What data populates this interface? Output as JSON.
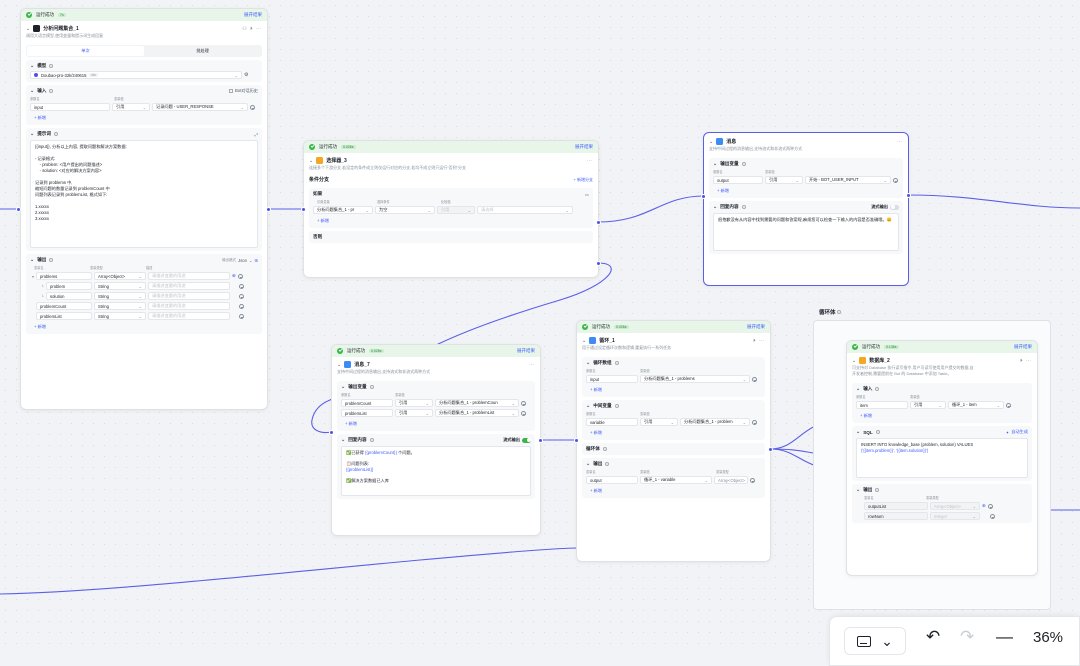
{
  "run_status": "运行成功",
  "expand_label": "展开结果",
  "add_label": "+ 新增",
  "node_llm": {
    "duration": "7s",
    "title": "分析问题集合_1",
    "desc": "调用大语言模型,使用变量和提示词生成回复",
    "tabs": [
      "单次",
      "批处理"
    ],
    "model_label": "模型",
    "model_value": "Doubao-pro-32k/240615",
    "model_tag": "ctx",
    "input_label": "输入",
    "history_label": "Bot对话历史",
    "col_name": "参数名",
    "col_value": "变量值",
    "input_rows": [
      {
        "name": "input",
        "ref": "引用",
        "value": "记录问题 - USER_RESPONSE"
      }
    ],
    "prompt_label": "提示词",
    "prompt_lines": [
      "{{input}}, 分析以上内容, 提取问题和解决方案数据:",
      "",
      "- 记录格式:",
      "    - problem: <用户提出的问题描述>",
      "    - solution: <对应的解决方案内容>",
      "",
      "记录到 problems 中,",
      "缩短问题的数量记录到 problemCount 中",
      "问题列表记录到 problemList, 格式如下:",
      "",
      "1.xxxxx",
      "2.xxxxx",
      "3.xxxxx"
    ],
    "output_label": "输出",
    "output_format_label": "输出格式",
    "output_format": "Json",
    "col_varname": "变量名",
    "col_vartype": "变量类型",
    "col_desc": "描述",
    "desc_placeholder": "请描述变量的用途",
    "output_rows": [
      {
        "name": "problems",
        "type": "Array<Object>",
        "indent": 0
      },
      {
        "name": "problem",
        "type": "String",
        "indent": 1
      },
      {
        "name": "solution",
        "type": "String",
        "indent": 1
      },
      {
        "name": "problemCount",
        "type": "String",
        "indent": 0
      },
      {
        "name": "problemList",
        "type": "String",
        "indent": 0
      }
    ]
  },
  "node_selector": {
    "duration": "0.026s",
    "title": "选择器_3",
    "desc": "连接多个下游分支,若设定的条件成立则仅运行对应的分支,若均不成立则只运行\"否则\"分支",
    "branch_label": "条件分支",
    "add_branch": "新增分支",
    "if_label": "如果",
    "col_ref": "引用变量",
    "col_op": "选择条件",
    "col_cmp": "比较值",
    "cond_ref": "分析问题集合_1 - pr",
    "cond_op": "为空",
    "cond_cmp_ref": "引用",
    "cond_cmp_ph": "请选择",
    "else_label": "否则"
  },
  "node_msg1": {
    "title": "消息",
    "desc": "支持中间过程的消息输出,支持流式和非流式两种方式",
    "output_var_label": "输出变量",
    "rows": [
      {
        "name": "output",
        "ref": "引用",
        "value": "开始 - BOT_USER_INPUT"
      }
    ],
    "reply_label": "回复内容",
    "stream_label": "流式输出",
    "reply_text": "很抱歉没有从内容中找到需要的问题和答案呢,麻烦您可以检查一下输入的内容是否准确哦。😊"
  },
  "node_msg7": {
    "duration": "0.026s",
    "title": "消息_7",
    "desc": "支持中间过程的消息输出,支持流式和非流式两种方式",
    "output_var_label": "输出变量",
    "rows": [
      {
        "name": "problemCount",
        "ref": "引用",
        "value": "分析问题集合_1 - problemCoun"
      },
      {
        "name": "problemList",
        "ref": "引用",
        "value": "分析问题集合_1 - problemList"
      }
    ],
    "reply_label": "回复内容",
    "stream_label": "流式输出",
    "reply_lines": [
      {
        "pre": "✅已获得 ",
        "var": "{{problemCount}}",
        "post": " 个问题。"
      },
      {
        "pre": "",
        "var": "",
        "post": ""
      },
      {
        "pre": "📋问题列表:",
        "var": "",
        "post": ""
      },
      {
        "pre": "",
        "var": "{{problemList}}",
        "post": ""
      },
      {
        "pre": "",
        "var": "",
        "post": ""
      },
      {
        "pre": "✅解决方案数据已入库",
        "var": "",
        "post": ""
      }
    ]
  },
  "node_loop": {
    "duration": "0.026s",
    "title": "循环_1",
    "desc": "用于通过设定循环次数和逻辑,重复执行一系列任务",
    "loop_array_label": "循环数组",
    "loop_rows": [
      {
        "name": "input",
        "value": "分析问题集合_1 - problems"
      }
    ],
    "mid_label": "中间变量",
    "mid_rows": [
      {
        "name": "variable",
        "ref": "引用",
        "value": "分析问题集合_1 - problem"
      }
    ],
    "body_label": "循环体",
    "output_label": "输出",
    "col_type": "变量类型",
    "out_rows": [
      {
        "name": "output",
        "value": "循环_1 - variable",
        "type": "Array<Object>"
      }
    ]
  },
  "loop_body": {
    "label": "循环体",
    "node": {
      "duration": "0.136s",
      "title": "数据库_2",
      "desc": "可支持对 Database 执行读写指令,用户可读写使用用户提交的数据,自",
      "desc2": "开发者控制,需要提前在 Bot 的 Database 中添加 Table。",
      "input_label": "输入",
      "rows": [
        {
          "name": "item",
          "ref": "引用",
          "value": "循环_1 - item"
        }
      ],
      "sql_label": "SQL",
      "sql_auto": "自动生成",
      "sql_line1": "INSERT INTO knowledge_base (problem, solution) VALUES",
      "sql_line2": "('{{item.problem}}', '{{item.solution}}')",
      "output_label": "输出",
      "out_rows": [
        {
          "name": "outputList",
          "type": "Array<Object>"
        },
        {
          "name": "rowNum",
          "type": "Integer"
        }
      ]
    }
  },
  "toolbar": {
    "zoom": "36%"
  },
  "colors": {
    "accent": "#3d5afe",
    "port": "#4d53e8",
    "success": "#3ab54a",
    "edge": "#5b5fe8"
  },
  "icons": [
    "llm-icon",
    "selector-icon",
    "message-icon",
    "loop-icon",
    "database-icon",
    "minimap-icon",
    "undo-icon",
    "redo-icon",
    "zoom-out-icon"
  ]
}
